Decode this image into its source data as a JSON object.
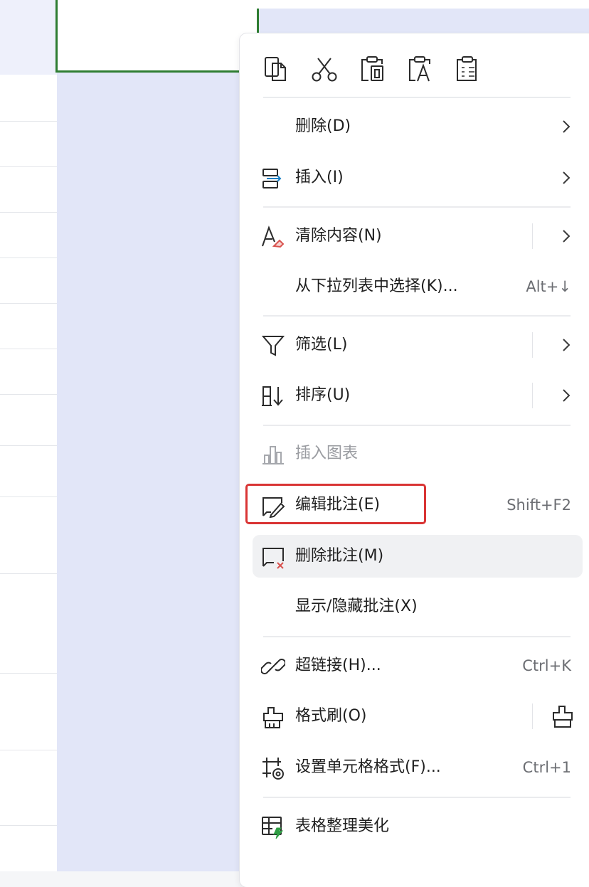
{
  "context_menu": {
    "clipboard_tools": [
      {
        "icon": "copy-icon"
      },
      {
        "icon": "cut-icon"
      },
      {
        "icon": "paste-icon"
      },
      {
        "icon": "paste-text-icon"
      },
      {
        "icon": "paste-special-icon"
      }
    ],
    "items": {
      "delete": {
        "label": "删除(D)",
        "icon": ""
      },
      "insert": {
        "label": "插入(I)",
        "icon": "insert-icon"
      },
      "clear_content": {
        "label": "清除内容(N)",
        "icon": "clear-content-icon"
      },
      "pick_from_list": {
        "label": "从下拉列表中选择(K)...",
        "shortcut": "Alt+↓"
      },
      "filter": {
        "label": "筛选(L)",
        "icon": "filter-icon"
      },
      "sort": {
        "label": "排序(U)",
        "icon": "sort-icon"
      },
      "insert_chart": {
        "label": "插入图表",
        "icon": "chart-icon",
        "disabled": true
      },
      "edit_comment": {
        "label": "编辑批注(E)",
        "shortcut": "Shift+F2",
        "icon": "edit-comment-icon"
      },
      "delete_comment": {
        "label": "删除批注(M)",
        "icon": "delete-comment-icon",
        "state": "hover"
      },
      "toggle_comment": {
        "label": "显示/隐藏批注(X)"
      },
      "hyperlink": {
        "label": "超链接(H)...",
        "shortcut": "Ctrl+K",
        "icon": "link-icon"
      },
      "format_painter": {
        "label": "格式刷(O)",
        "icon": "format-painter-icon"
      },
      "format_cells": {
        "label": "设置单元格格式(F)...",
        "shortcut": "Ctrl+1",
        "icon": "format-cells-icon"
      },
      "beautify_table": {
        "label": "表格整理美化",
        "icon": "beautify-table-icon"
      }
    }
  },
  "colors": {
    "highlight_border": "#d93434",
    "active_cell_border": "#2e7d32",
    "selection_fill": "#e2e6f8"
  }
}
